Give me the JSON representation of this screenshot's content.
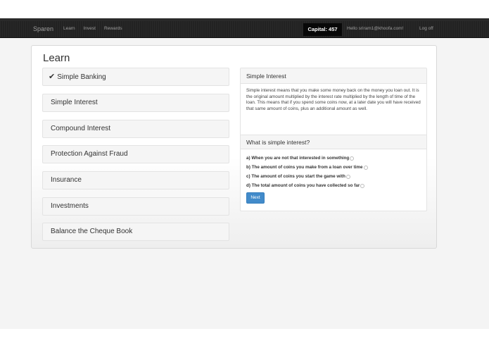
{
  "navbar": {
    "brand": "Sparen",
    "links": [
      "Learn",
      "Invest",
      "Rewards"
    ],
    "capital": "Capital: 457",
    "greeting": "Hello sriram1@khoofa.com!",
    "logoff": "Log off"
  },
  "learn": {
    "title": "Learn",
    "topics": [
      {
        "label": "Simple Banking",
        "completed": true
      },
      {
        "label": "Simple Interest",
        "completed": false
      },
      {
        "label": "Compound Interest",
        "completed": false
      },
      {
        "label": "Protection Against Fraud",
        "completed": false
      },
      {
        "label": "Insurance",
        "completed": false
      },
      {
        "label": "Investments",
        "completed": false
      },
      {
        "label": "Balance the Cheque Book",
        "completed": false
      }
    ]
  },
  "lesson": {
    "title": "Simple Interest",
    "body": "Simple interest means that you make some money back on the money you loan out. It is the original amount multiplied by the interest rate multiplied by the length of time of the loan. This means that if you spend some coins now, at a later date you will have received that same amount of coins, plus an additional amount as well.",
    "question": "What is simple interest?",
    "answers": [
      "a) When you are not that interested in something",
      "b) The amount of coins you make from a loan over time",
      "c) The amount of coins you start the game with",
      "d) The total amount of coins you have collected so far"
    ],
    "next_label": "Next"
  },
  "colors": {
    "navbar_bg": "#222222",
    "button_primary": "#428bca"
  }
}
